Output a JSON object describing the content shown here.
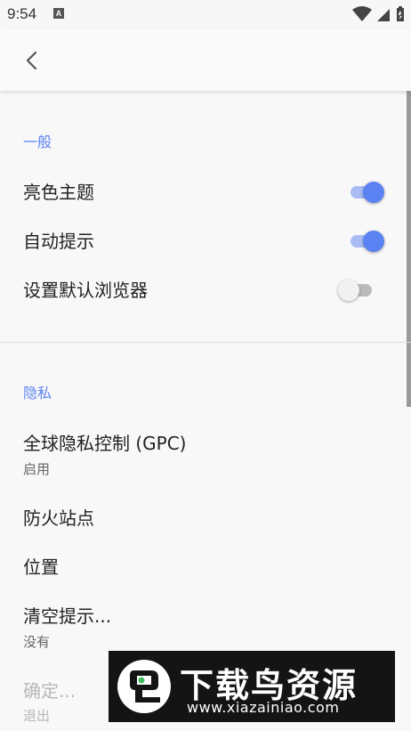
{
  "status_bar": {
    "time": "9:54",
    "notification_badge": "A",
    "icons": [
      "wifi-icon",
      "cell-signal-icon",
      "battery-icon"
    ]
  },
  "toolbar": {
    "back_icon": "back-chevron-icon"
  },
  "sections": {
    "general": {
      "header": "一般",
      "items": [
        {
          "title": "亮色主题",
          "switch_on": true
        },
        {
          "title": "自动提示",
          "switch_on": true
        },
        {
          "title": "设置默认浏览器",
          "switch_on": false
        }
      ]
    },
    "privacy": {
      "header": "隐私",
      "items": [
        {
          "title": "全球隐私控制 (GPC)",
          "summary": "启用"
        },
        {
          "title": "防火站点"
        },
        {
          "title": "位置"
        },
        {
          "title": "清空提示...",
          "summary": "没有"
        },
        {
          "title": "确定...",
          "summary": "退出",
          "disabled": true
        }
      ]
    }
  },
  "watermark": {
    "title": "下载鸟资源",
    "url": "www.xiazainiao.com"
  },
  "colors": {
    "accent": "#5b82f2",
    "accent_track": "#a9bcf5",
    "section_header": "#5c84f2",
    "background": "#f8f8f8"
  }
}
